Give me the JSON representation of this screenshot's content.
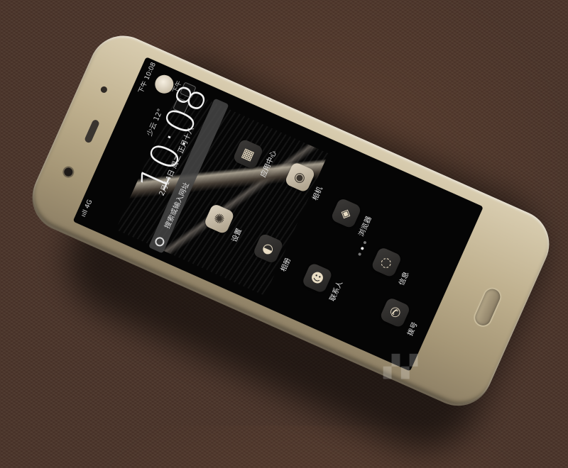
{
  "status_bar": {
    "signal": "ııll 4G",
    "time": "下午 10:08"
  },
  "weather": "少云 12°",
  "clock": {
    "time": "10:08",
    "ampm": "下午",
    "date": "2月14日 周二 正月十八"
  },
  "search": {
    "placeholder": "搜索或输入网址"
  },
  "apps": [
    {
      "name": "设置",
      "icon": "gear-icon",
      "glyph": "✺"
    },
    {
      "name": "应用中心",
      "icon": "store-icon",
      "glyph": "▦"
    },
    {
      "name": "相机",
      "icon": "camera-icon",
      "glyph": "◉"
    },
    {
      "name": "相册",
      "icon": "gallery-icon",
      "glyph": "◒"
    },
    {
      "name": "浏览器",
      "icon": "globe-icon",
      "glyph": "◈"
    },
    {
      "name": "联系人",
      "icon": "contacts-icon",
      "glyph": "☻"
    },
    {
      "name": "信息",
      "icon": "message-icon",
      "glyph": "◌"
    },
    {
      "name": "拨号",
      "icon": "phone-icon",
      "glyph": "✆"
    }
  ]
}
